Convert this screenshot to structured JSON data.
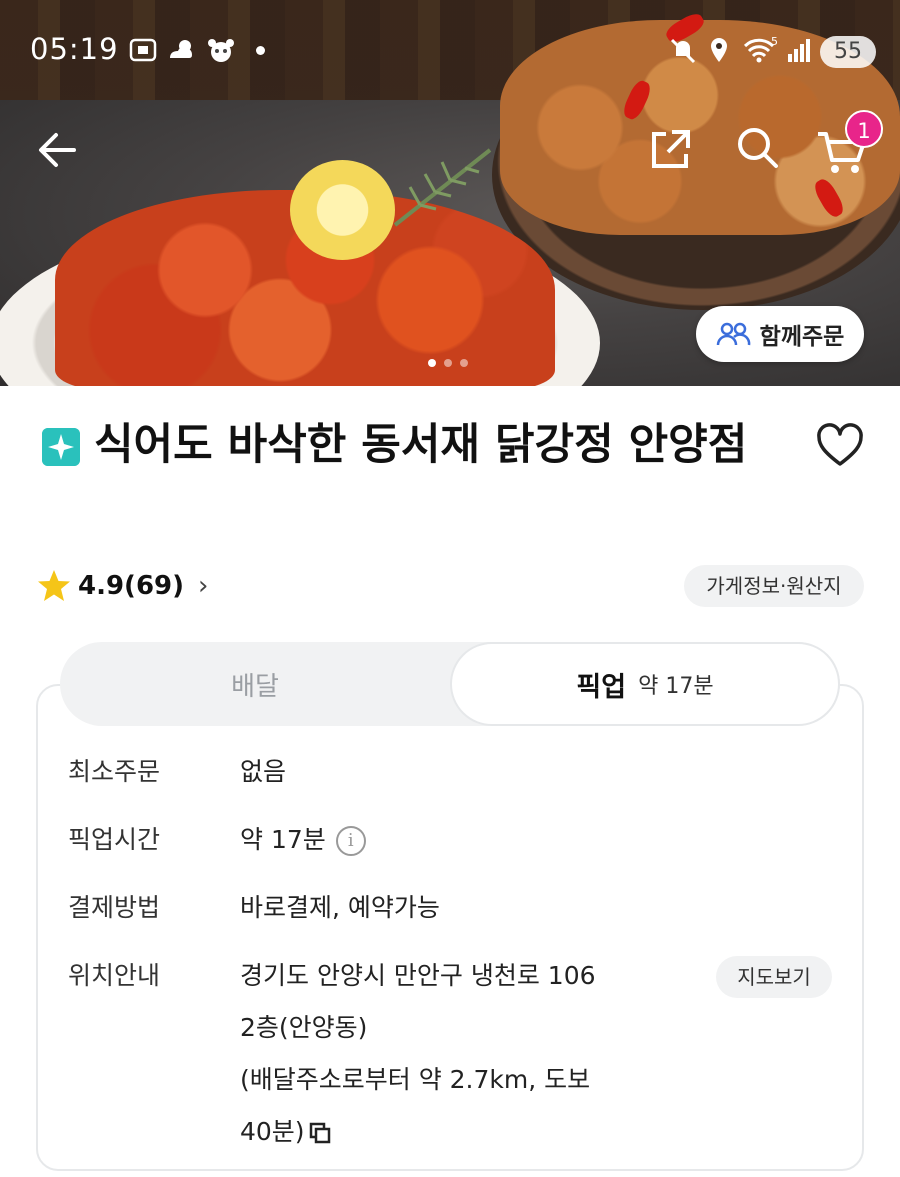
{
  "status_bar": {
    "time": "05:19",
    "battery": "55",
    "signal_badge": "5"
  },
  "nav": {
    "cart_count": "1",
    "group_order_label": "함께주문"
  },
  "store": {
    "name": "식어도 바삭한 동서재 닭강정 안양점",
    "rating": "4.9(69)",
    "info_link": "가게정보·원산지"
  },
  "tabs": [
    {
      "label": "배달",
      "selected": false
    },
    {
      "label": "픽업",
      "sub": "약 17분",
      "selected": true
    }
  ],
  "details": {
    "min_order": {
      "label": "최소주문",
      "value": "없음"
    },
    "pickup_time": {
      "label": "픽업시간",
      "value": "약 17분"
    },
    "payment": {
      "label": "결제방법",
      "value": "바로결제, 예약가능"
    },
    "location": {
      "label": "위치안내",
      "line1": "경기도 안양시 만안구 냉천로 106",
      "line2": "2층(안양동)",
      "line3": "(배달주소로부터 약 2.7km, 도보",
      "line4": "40분)",
      "map_button": "지도보기"
    }
  },
  "colors": {
    "brand_mint": "#2ac1bc",
    "badge_pink": "#e8258a",
    "star_yellow": "#f5c518"
  }
}
